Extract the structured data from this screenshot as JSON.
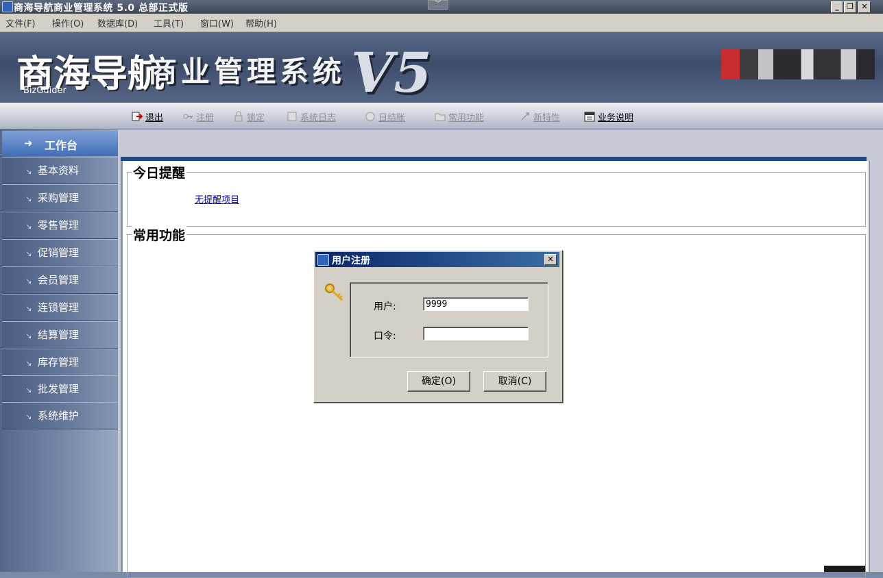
{
  "window": {
    "title": "商海导航商业管理系统 5.0 总部正式版",
    "dropdown_glyph": "﹀",
    "controls": {
      "minimize": "_",
      "restore": "❐",
      "close": "✕"
    }
  },
  "menubar": [
    {
      "label": "文件(F)"
    },
    {
      "label": "操作(O)"
    },
    {
      "label": "数据库(D)"
    },
    {
      "label": "工具(T)"
    },
    {
      "label": "窗口(W)"
    },
    {
      "label": "帮助(H)"
    }
  ],
  "banner": {
    "logo_text": "商海导航",
    "logo_sub": "BizGuider",
    "system_name": "商业管理系统",
    "version": "V5"
  },
  "toolbar": [
    {
      "label": "退出",
      "icon": "exit-icon",
      "enabled": true
    },
    {
      "label": "注册",
      "icon": "register-icon",
      "enabled": false
    },
    {
      "label": "锁定",
      "icon": "lock-icon",
      "enabled": false
    },
    {
      "label": "系统日志",
      "icon": "log-icon",
      "enabled": false
    },
    {
      "label": "日结账",
      "icon": "day-close-icon",
      "enabled": false
    },
    {
      "label": "常用功能",
      "icon": "folder-icon",
      "enabled": false
    },
    {
      "label": "新特性",
      "icon": "new-features-icon",
      "enabled": false
    },
    {
      "label": "业务说明",
      "icon": "calendar-icon",
      "enabled": true
    }
  ],
  "sidebar": {
    "header": "工作台",
    "items": [
      {
        "label": "基本资料"
      },
      {
        "label": "采购管理"
      },
      {
        "label": "零售管理"
      },
      {
        "label": "促销管理"
      },
      {
        "label": "会员管理"
      },
      {
        "label": "连锁管理"
      },
      {
        "label": "结算管理"
      },
      {
        "label": "库存管理"
      },
      {
        "label": "批发管理"
      },
      {
        "label": "系统维护"
      }
    ]
  },
  "main": {
    "reminders": {
      "title": "今日提醒",
      "empty_link": "无提醒项目"
    },
    "common_functions": {
      "title": "常用功能"
    }
  },
  "dialog": {
    "title": "用户注册",
    "user_label": "用户:",
    "user_value": "9999",
    "password_label": "口令:",
    "password_value": "",
    "ok_button": "确定(O)",
    "cancel_button": "取消(C)",
    "close_glyph": "✕"
  }
}
